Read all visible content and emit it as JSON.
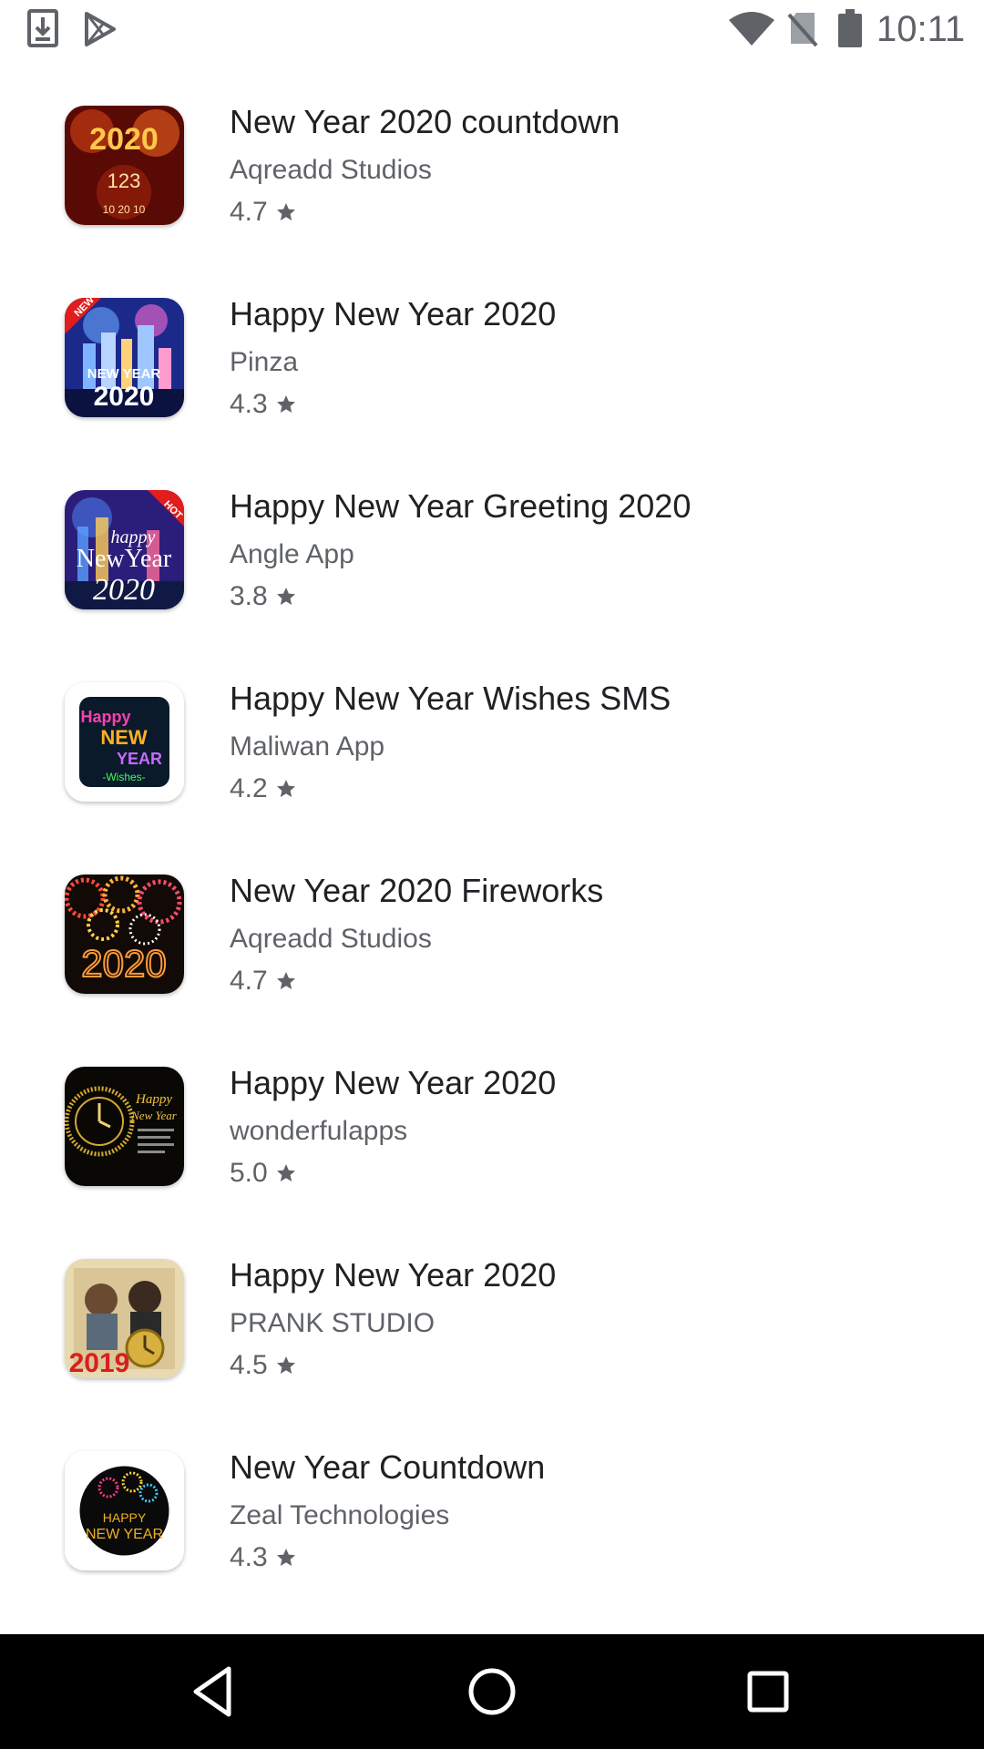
{
  "status_bar": {
    "time": "10:11",
    "icons": [
      "download-icon",
      "play-store-icon",
      "wifi-icon",
      "no-sim-icon",
      "battery-icon"
    ]
  },
  "apps": [
    {
      "title": "New Year 2020 countdown",
      "developer": "Aqreadd Studios",
      "rating": "4.7",
      "icon": "fireworks-2020-countdown-icon"
    },
    {
      "title": "Happy New Year 2020",
      "developer": "Pinza",
      "rating": "4.3",
      "icon": "new-year-city-2020-icon",
      "icon_badge": "NEW",
      "icon_text": [
        "NEW YEAR",
        "2020"
      ]
    },
    {
      "title": "Happy New Year Greeting 2020",
      "developer": "Angle App",
      "rating": "3.8",
      "icon": "greeting-2020-icon",
      "icon_badge": "HOT",
      "icon_text": [
        "happy",
        "NewYear",
        "2020"
      ]
    },
    {
      "title": "Happy New Year Wishes SMS",
      "developer": "Maliwan App",
      "rating": "4.2",
      "icon": "wishes-sms-icon",
      "icon_text": [
        "Happy",
        "NEW",
        "YEAR",
        "-Wishes-"
      ]
    },
    {
      "title": "New Year 2020 Fireworks",
      "developer": "Aqreadd Studios",
      "rating": "4.7",
      "icon": "fireworks-2020-icon",
      "icon_text": [
        "2020"
      ]
    },
    {
      "title": "Happy New Year 2020",
      "developer": "wonderfulapps",
      "rating": "5.0",
      "icon": "clock-new-year-icon",
      "icon_text": [
        "Happy",
        "New Year"
      ]
    },
    {
      "title": "Happy New Year 2020",
      "developer": "PRANK STUDIO",
      "rating": "4.5",
      "icon": "photo-frame-2019-icon",
      "icon_text": [
        "2019"
      ]
    },
    {
      "title": "New Year Countdown",
      "developer": "Zeal Technologies",
      "rating": "4.3",
      "icon": "happy-new-year-circle-icon",
      "icon_text": [
        "HAPPY",
        "NEW YEAR"
      ]
    }
  ],
  "nav_bar": {
    "buttons": [
      "back-icon",
      "home-icon",
      "recents-icon"
    ]
  },
  "colors": {
    "title": "#202124",
    "secondary": "#5f6368",
    "nav_background": "#000000"
  }
}
